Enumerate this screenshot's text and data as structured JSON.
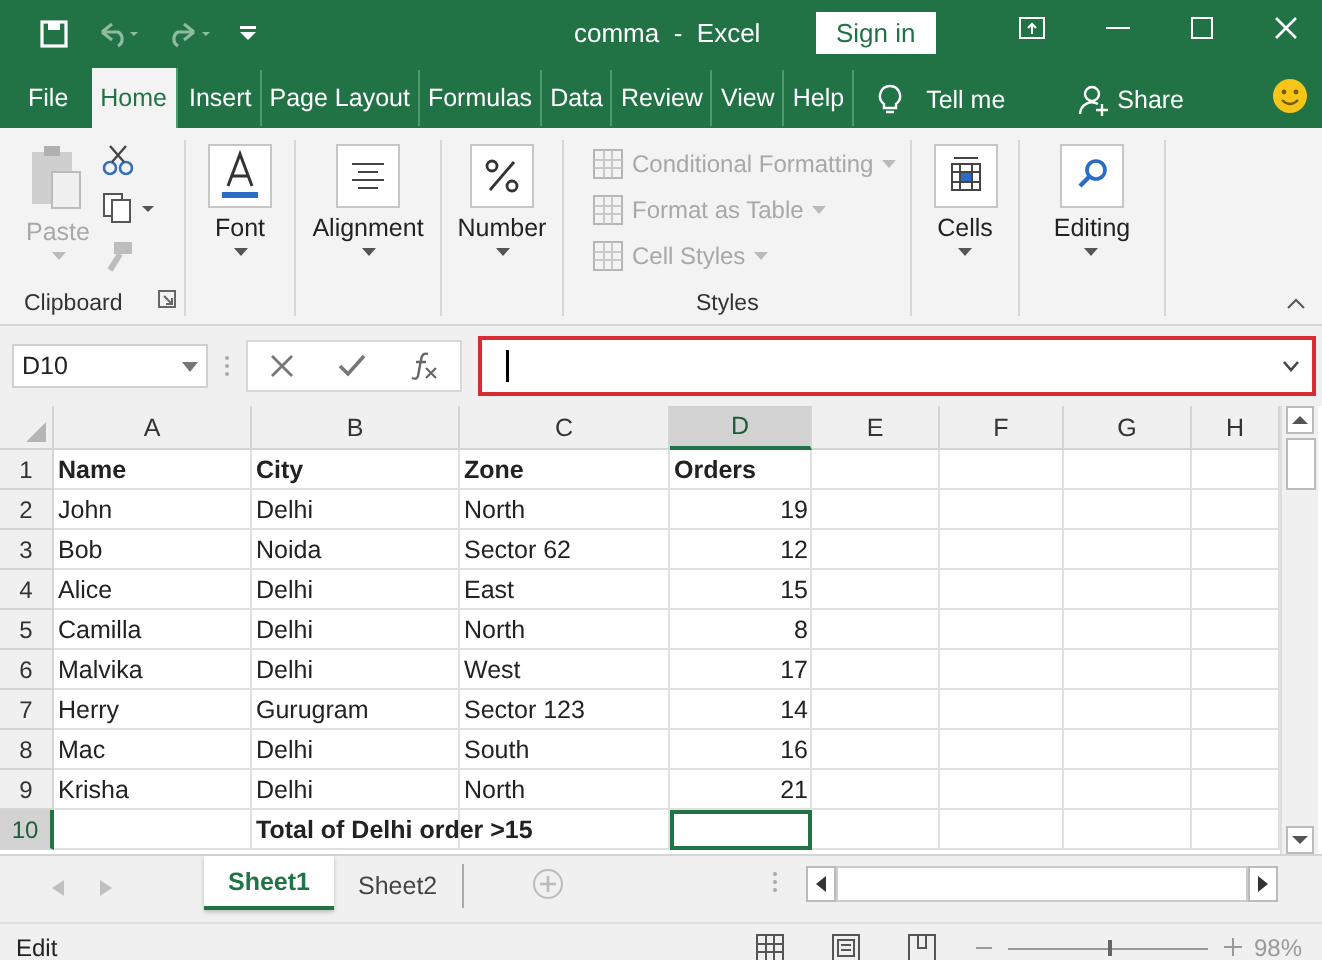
{
  "title_bar": {
    "title": "comma  -  Excel",
    "sign_in": "Sign in"
  },
  "menu_tabs": [
    {
      "label": "File",
      "selected": false
    },
    {
      "label": "Home",
      "selected": true
    },
    {
      "label": "Insert",
      "selected": false
    },
    {
      "label": "Page Layout",
      "selected": false
    },
    {
      "label": "Formulas",
      "selected": false
    },
    {
      "label": "Data",
      "selected": false
    },
    {
      "label": "Review",
      "selected": false
    },
    {
      "label": "View",
      "selected": false
    },
    {
      "label": "Help",
      "selected": false
    }
  ],
  "tell_me": "Tell me",
  "share": "Share",
  "ribbon": {
    "clipboard": {
      "paste": "Paste",
      "label": "Clipboard"
    },
    "font": "Font",
    "alignment": "Alignment",
    "number": "Number",
    "styles": {
      "items": [
        {
          "label": "Conditional Formatting",
          "disabled": true
        },
        {
          "label": "Format as Table",
          "disabled": true
        },
        {
          "label": "Cell Styles",
          "disabled": true
        }
      ],
      "label": "Styles"
    },
    "cells": "Cells",
    "editing": "Editing"
  },
  "name_box": "D10",
  "columns": [
    {
      "label": "A",
      "selected": false
    },
    {
      "label": "B",
      "selected": false
    },
    {
      "label": "C",
      "selected": false
    },
    {
      "label": "D",
      "selected": true
    },
    {
      "label": "E",
      "selected": false
    },
    {
      "label": "F",
      "selected": false
    },
    {
      "label": "G",
      "selected": false
    },
    {
      "label": "H",
      "selected": false
    }
  ],
  "rows": [
    {
      "label": "1",
      "kind": "header",
      "selected": false,
      "cells": [
        "Name",
        "City",
        "Zone",
        "Orders"
      ]
    },
    {
      "label": "2",
      "kind": "data",
      "selected": false,
      "cells": [
        "John",
        "Delhi",
        "North",
        "19"
      ]
    },
    {
      "label": "3",
      "kind": "data",
      "selected": false,
      "cells": [
        "Bob",
        "Noida",
        "Sector 62",
        "12"
      ]
    },
    {
      "label": "4",
      "kind": "data",
      "selected": false,
      "cells": [
        "Alice",
        "Delhi",
        "East",
        "15"
      ]
    },
    {
      "label": "5",
      "kind": "data",
      "selected": false,
      "cells": [
        "Camilla",
        "Delhi",
        "North",
        "8"
      ]
    },
    {
      "label": "6",
      "kind": "data",
      "selected": false,
      "cells": [
        "Malvika",
        "Delhi",
        "West",
        "17"
      ]
    },
    {
      "label": "7",
      "kind": "data",
      "selected": false,
      "cells": [
        "Herry",
        "Gurugram",
        "Sector 123",
        "14"
      ]
    },
    {
      "label": "8",
      "kind": "data",
      "selected": false,
      "cells": [
        "Mac",
        "Delhi",
        "South",
        "16"
      ]
    },
    {
      "label": "9",
      "kind": "data",
      "selected": false,
      "cells": [
        "Krisha",
        "Delhi",
        "North",
        "21"
      ]
    },
    {
      "label": "10",
      "kind": "total",
      "selected": true,
      "cells": [
        null,
        "Total of Delhi order >15"
      ]
    }
  ],
  "sheets": [
    {
      "label": "Sheet1",
      "selected": true
    },
    {
      "label": "Sheet2",
      "selected": false
    }
  ],
  "status_bar": {
    "mode": "Edit",
    "zoom": "98%",
    "zoom_slider": {
      "level": 0.5
    }
  }
}
